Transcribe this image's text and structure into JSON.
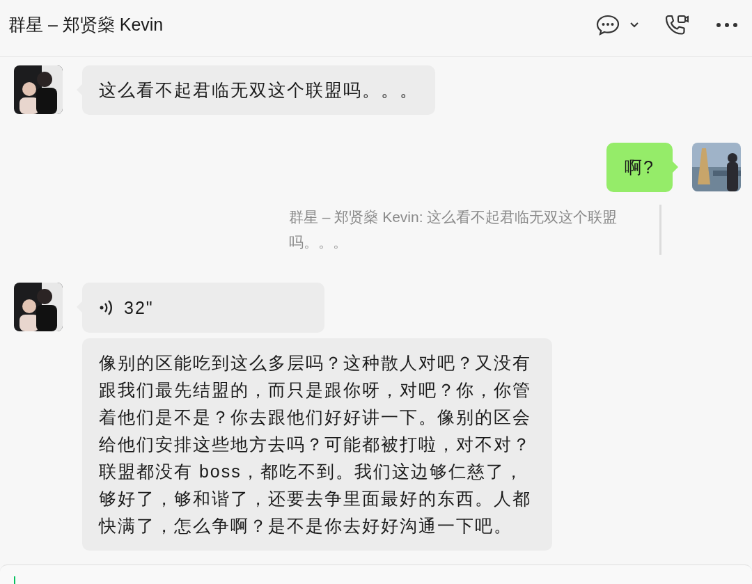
{
  "header": {
    "title": "群星 – 郑贤燊 Kevin"
  },
  "messages": [
    {
      "kind": "text",
      "outgoing": false,
      "text": "这么看不起君临无双这个联盟吗。。。"
    },
    {
      "kind": "text",
      "outgoing": true,
      "text": "啊?",
      "quote": "群星 – 郑贤燊 Kevin: 这么看不起君临无双这个联盟吗。。。"
    },
    {
      "kind": "voice",
      "outgoing": false,
      "duration": "32\""
    },
    {
      "kind": "text",
      "outgoing": false,
      "avatar": false,
      "text": "像别的区能吃到这么多层吗？这种散人对吧？又没有跟我们最先结盟的，而只是跟你呀，对吧？你，你管着他们是不是？你去跟他们好好讲一下。像别的区会给他们安排这些地方去吗？可能都被打啦，对不对？联盟都没有 boss，都吃不到。我们这边够仁慈了，够好了，够和谐了，还要去争里面最好的东西。人都快满了，怎么争啊？是不是你去好好沟通一下吧。"
    }
  ]
}
